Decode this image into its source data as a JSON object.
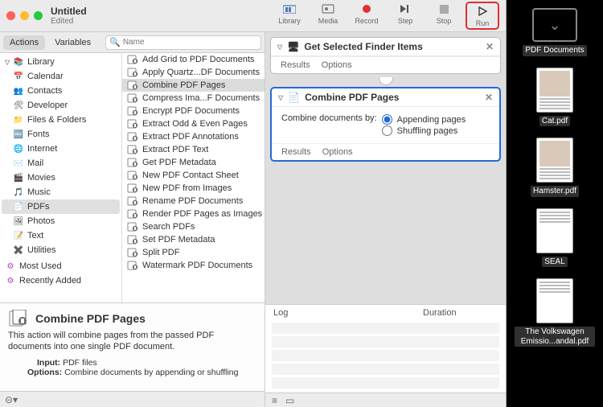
{
  "window": {
    "title": "Untitled",
    "subtitle": "Edited"
  },
  "toolbar": {
    "library": "Library",
    "media": "Media",
    "record": "Record",
    "step": "Step",
    "stop": "Stop",
    "run": "Run"
  },
  "tabs": {
    "actions": "Actions",
    "variables": "Variables"
  },
  "search": {
    "placeholder": "Name"
  },
  "library": {
    "root": "Library",
    "items": [
      {
        "label": "Calendar",
        "icon": "📅",
        "name": "calendar"
      },
      {
        "label": "Contacts",
        "icon": "👥",
        "name": "contacts"
      },
      {
        "label": "Developer",
        "icon": "🛠",
        "name": "developer"
      },
      {
        "label": "Files & Folders",
        "icon": "📁",
        "name": "files-folders"
      },
      {
        "label": "Fonts",
        "icon": "🔤",
        "name": "fonts"
      },
      {
        "label": "Internet",
        "icon": "🌐",
        "name": "internet"
      },
      {
        "label": "Mail",
        "icon": "✉️",
        "name": "mail"
      },
      {
        "label": "Movies",
        "icon": "🎬",
        "name": "movies"
      },
      {
        "label": "Music",
        "icon": "🎵",
        "name": "music"
      },
      {
        "label": "PDFs",
        "icon": "📄",
        "name": "pdfs",
        "selected": true
      },
      {
        "label": "Photos",
        "icon": "🖼",
        "name": "photos"
      },
      {
        "label": "Text",
        "icon": "📝",
        "name": "text"
      },
      {
        "label": "Utilities",
        "icon": "✖️",
        "name": "utilities"
      }
    ],
    "most_used": "Most Used",
    "recently_added": "Recently Added"
  },
  "actions": [
    {
      "label": "Add Grid to PDF Documents"
    },
    {
      "label": "Apply Quartz...DF Documents"
    },
    {
      "label": "Combine PDF Pages",
      "selected": true
    },
    {
      "label": "Compress Ima...F Documents"
    },
    {
      "label": "Encrypt PDF Documents"
    },
    {
      "label": "Extract Odd & Even Pages"
    },
    {
      "label": "Extract PDF Annotations"
    },
    {
      "label": "Extract PDF Text"
    },
    {
      "label": "Get PDF Metadata"
    },
    {
      "label": "New PDF Contact Sheet"
    },
    {
      "label": "New PDF from Images"
    },
    {
      "label": "Rename PDF Documents"
    },
    {
      "label": "Render PDF Pages as Images"
    },
    {
      "label": "Search PDFs"
    },
    {
      "label": "Set PDF Metadata"
    },
    {
      "label": "Split PDF"
    },
    {
      "label": "Watermark PDF Documents"
    }
  ],
  "info": {
    "title": "Combine PDF Pages",
    "desc": "This action will combine pages from the passed PDF documents into one single PDF document.",
    "input_label": "Input:",
    "input_val": "PDF files",
    "options_label": "Options:",
    "options_val": "Combine documents by appending or shuffling"
  },
  "workflow": {
    "step1": {
      "title": "Get Selected Finder Items",
      "results": "Results",
      "options": "Options"
    },
    "step2": {
      "title": "Combine PDF Pages",
      "combine_label": "Combine documents by:",
      "opt_append": "Appending pages",
      "opt_shuffle": "Shuffling pages",
      "selected": "append",
      "results": "Results",
      "options": "Options"
    }
  },
  "log": {
    "col1": "Log",
    "col2": "Duration"
  },
  "desktop": [
    {
      "type": "folder",
      "label": "PDF Documents"
    },
    {
      "type": "doc",
      "label": "Cat.pdf",
      "thumb": true
    },
    {
      "type": "doc",
      "label": "Hamster.pdf",
      "thumb": true
    },
    {
      "type": "doc",
      "label": "SEAL",
      "thumb": false
    },
    {
      "type": "doc",
      "label": "The Volkswagen Emissio...andal.pdf",
      "thumb": false
    }
  ]
}
